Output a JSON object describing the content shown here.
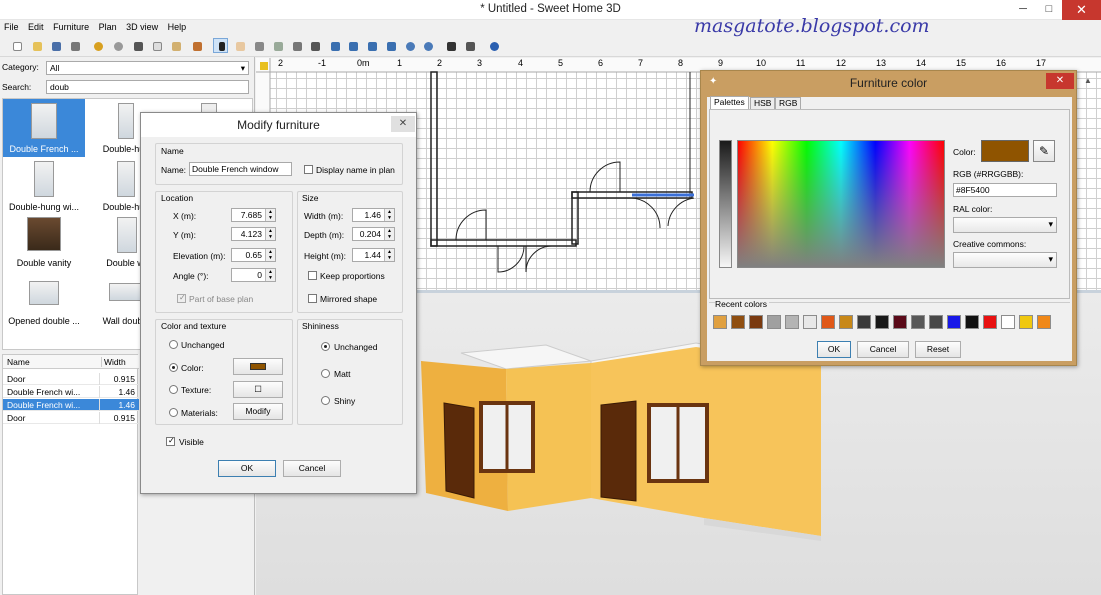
{
  "app": {
    "title": "* Untitled - Sweet Home 3D",
    "watermark": "masgatote.blogspot.com",
    "win_buttons": {
      "minimize": "─",
      "maximize": "□",
      "close": "✕"
    }
  },
  "menu": [
    "File",
    "Edit",
    "Furniture",
    "Plan",
    "3D view",
    "Help"
  ],
  "left": {
    "category_label": "Category:",
    "category_value": "All",
    "search_label": "Search:",
    "search_value": "doub",
    "catalog": [
      {
        "label": "Double French ...",
        "selected": true
      },
      {
        "label": "Double-hun",
        "selected": false
      },
      {
        "label": "Double-hung wi...",
        "selected": false
      },
      {
        "label": "Double-hun",
        "selected": false
      },
      {
        "label": "Double vanity",
        "selected": false
      },
      {
        "label": "Double wi",
        "selected": false
      },
      {
        "label": "Opened double ...",
        "selected": false
      },
      {
        "label": "Wall double",
        "selected": false
      }
    ],
    "list_headers": {
      "name": "Name",
      "width": "Width"
    },
    "list_rows": [
      {
        "name": "Door",
        "width": "0.915"
      },
      {
        "name": "Double French wi...",
        "width": "1.46"
      },
      {
        "name": "Double French wi...",
        "width": "1.46"
      },
      {
        "name": "Door",
        "width": "0.915"
      }
    ]
  },
  "ruler": {
    "labels": [
      "2",
      "-1",
      "0m",
      "1",
      "2",
      "3",
      "4",
      "5",
      "6",
      "7",
      "8",
      "9",
      "10",
      "11",
      "12",
      "13",
      "14",
      "15",
      "16",
      "17"
    ]
  },
  "modify": {
    "title": "Modify furniture",
    "name_group": "Name",
    "name_label": "Name:",
    "name_value": "Double French window",
    "display_name": "Display name in plan",
    "location_group": "Location",
    "x_label": "X (m):",
    "x_value": "7.685",
    "y_label": "Y (m):",
    "y_value": "4.123",
    "elev_label": "Elevation (m):",
    "elev_value": "0.65",
    "angle_label": "Angle (°):",
    "angle_value": "0",
    "base_plan": "Part of base plan",
    "size_group": "Size",
    "width_label": "Width (m):",
    "width_value": "1.46",
    "depth_label": "Depth (m):",
    "depth_value": "0.204",
    "height_label": "Height (m):",
    "height_value": "1.44",
    "keep_prop": "Keep proportions",
    "mirrored": "Mirrored shape",
    "color_group": "Color and texture",
    "unchanged": "Unchanged",
    "color": "Color:",
    "texture": "Texture:",
    "materials": "Materials:",
    "modify_btn": "Modify",
    "texture_glyph": "☐",
    "shininess_group": "Shininess",
    "sh_unchanged": "Unchanged",
    "sh_matt": "Matt",
    "sh_shiny": "Shiny",
    "visible": "Visible",
    "ok": "OK",
    "cancel": "Cancel",
    "color_swatch": "#8F5400"
  },
  "colordlg": {
    "title": "Furniture color",
    "tabs": [
      "Palettes",
      "HSB",
      "RGB"
    ],
    "color_label": "Color:",
    "rgb_label": "RGB (#RRGGBB):",
    "rgb_value": "#8F5400",
    "ral_label": "RAL color:",
    "cc_label": "Creative commons:",
    "recent_label": "Recent colors",
    "recent": [
      "#e0a040",
      "#8f4e10",
      "#7a3a10",
      "#a0a0a0",
      "#b4b4b4",
      "#e8e8e8",
      "#e05818",
      "#c88818",
      "#3a3a3a",
      "#181818",
      "#5a0a18",
      "#585858",
      "#484848",
      "#1818e8",
      "#101010",
      "#e81010",
      "#ffffff",
      "#f0c810",
      "#f08818"
    ],
    "ok": "OK",
    "cancel": "Cancel",
    "reset": "Reset",
    "current": "#8F5400"
  }
}
